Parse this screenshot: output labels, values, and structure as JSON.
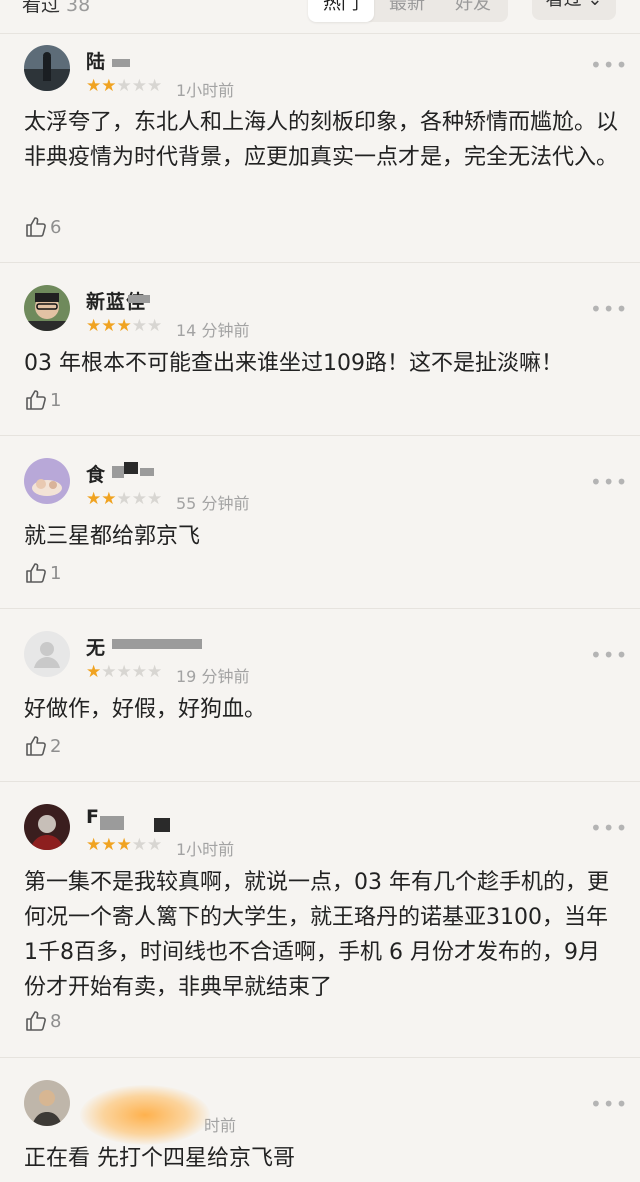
{
  "header": {
    "title": "看过",
    "count": "38",
    "tabs": [
      "热门",
      "最新",
      "好友"
    ],
    "active_tab": 0,
    "filter_label": "看过 ⌄"
  },
  "comments": [
    {
      "name": "陆",
      "rating": 2,
      "time": "1小时前",
      "text": "太浮夸了，东北人和上海人的刻板印象，各种矫情而尴尬。以非典疫情为时代背景，应更加真实一点才是，完全无法代入。",
      "likes": "6"
    },
    {
      "name": "新蓝佳",
      "rating": 3,
      "time": "14 分钟前",
      "text": "03 年根本不可能查出来谁坐过109路！这不是扯淡嘛！",
      "likes": "1"
    },
    {
      "name": "食",
      "rating": 2,
      "time": "55 分钟前",
      "text": "就三星都给郭京飞",
      "likes": "1"
    },
    {
      "name": "无",
      "rating": 1,
      "time": "19 分钟前",
      "text": "好做作，好假，好狗血。",
      "likes": "2"
    },
    {
      "name": "F",
      "rating": 3,
      "time": "1小时前",
      "text": "第一集不是我较真啊，就说一点，03 年有几个趁手机的，更何况一个寄人篱下的大学生，就王珞丹的诺基亚3100，当年1千8百多，时间线也不合适啊，手机 6 月份才发布的，9月份才开始有卖，非典早就结束了",
      "likes": "8"
    },
    {
      "name": "",
      "rating": 4,
      "time": "时前",
      "text": "正在看 先打个四星给京飞哥",
      "likes": ""
    }
  ],
  "colors": {
    "star_on": "#f0a321",
    "star_off": "#d8d6d2",
    "background": "#f6f4f1"
  },
  "icons": {
    "like": "thumbs-up-icon",
    "more": "more-dots-icon",
    "avatar": "user-avatar"
  }
}
